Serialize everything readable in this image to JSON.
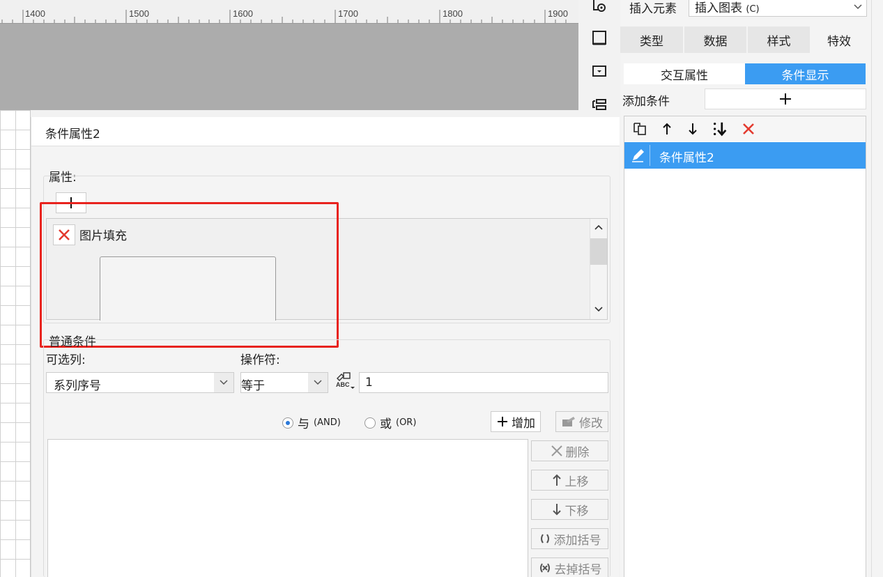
{
  "ruler": {
    "labels": [
      "1400",
      "1500",
      "1600",
      "1700",
      "1800",
      "1900"
    ]
  },
  "dialog": {
    "title": "条件属性2",
    "properties": {
      "section_label": "属性:",
      "items": [
        {
          "label": "图片填充"
        }
      ]
    },
    "normal_condition": {
      "section_label": "普通条件",
      "column_label": "可选列:",
      "column_value": "系列序号",
      "operator_label": "操作符:",
      "operator_value": "等于",
      "value": "1",
      "and_label": "与",
      "and_sub": "(AND)",
      "or_label": "或",
      "or_sub": "(OR)",
      "add_label": "增加",
      "modify_label": "修改",
      "delete_label": "删除",
      "move_up_label": "上移",
      "move_down_label": "下移",
      "add_bracket_label": "添加括号",
      "remove_bracket_label": "去掉括号"
    }
  },
  "right_panel": {
    "insert_element_label": "插入元素",
    "insert_chart_value": "插入图表",
    "insert_chart_shortcut": "(C)",
    "tabs": [
      "类型",
      "数据",
      "样式",
      "特效"
    ],
    "subtabs": [
      "交互属性",
      "条件显示"
    ],
    "add_condition_label": "添加条件",
    "conditions": [
      {
        "label": "条件属性2"
      }
    ]
  },
  "colors": {
    "accent": "#3b9cf2",
    "highlight_red": "#e8231e",
    "delete_red": "#e33a2f"
  }
}
